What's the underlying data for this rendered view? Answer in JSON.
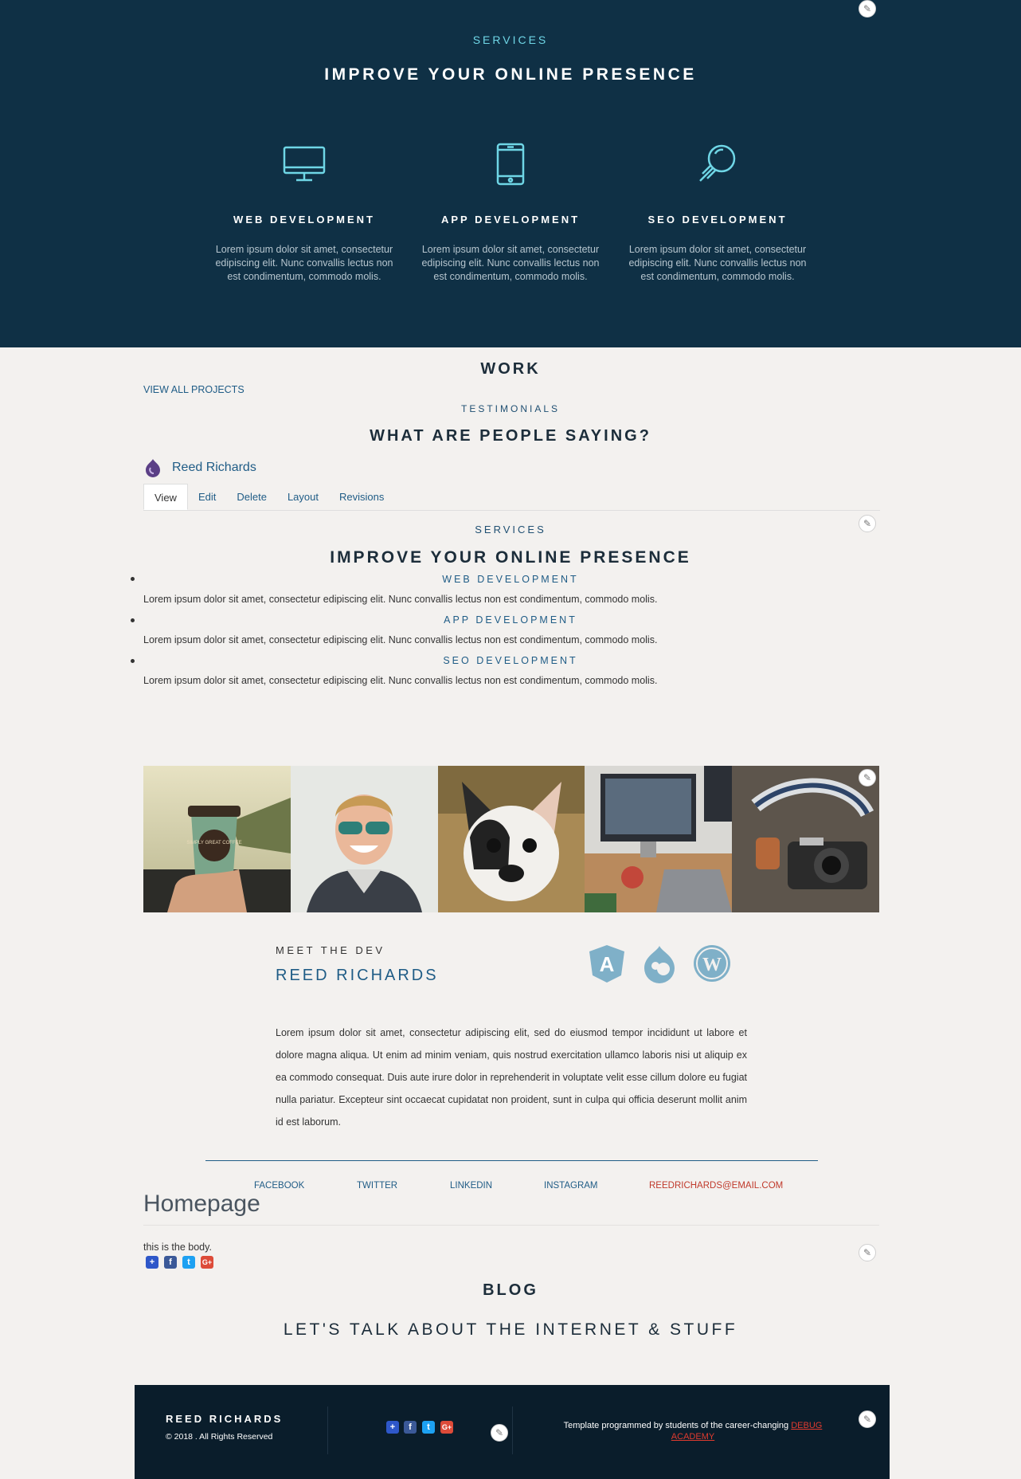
{
  "hero": {
    "eyebrow": "SERVICES",
    "headline": "IMPROVE YOUR ONLINE PRESENCE",
    "services": [
      {
        "title": "WEB DEVELOPMENT",
        "icon": "monitor-icon",
        "desc": "Lorem ipsum dolor sit amet, consectetur edipiscing elit. Nunc convallis lectus non est condimentum, commodo molis."
      },
      {
        "title": "APP DEVELOPMENT",
        "icon": "mobile-icon",
        "desc": "Lorem ipsum dolor sit amet, consectetur edipiscing elit. Nunc convallis lectus non est condimentum, commodo molis."
      },
      {
        "title": "SEO DEVELOPMENT",
        "icon": "magnifier-icon",
        "desc": "Lorem ipsum dolor sit amet, consectetur edipiscing elit. Nunc convallis lectus non est condimentum, commodo molis."
      }
    ]
  },
  "work": {
    "title": "WORK",
    "view_all": "VIEW ALL PROJECTS"
  },
  "testimonials": {
    "eyebrow": "TESTIMONIALS",
    "headline": "WHAT ARE PEOPLE SAYING?"
  },
  "author": {
    "name": "Reed Richards"
  },
  "tabs": [
    "View",
    "Edit",
    "Delete",
    "Layout",
    "Revisions"
  ],
  "services_list": {
    "eyebrow": "SERVICES",
    "headline": "IMPROVE YOUR ONLINE PRESENCE",
    "items": [
      {
        "title": "WEB DEVELOPMENT",
        "body": "Lorem ipsum dolor sit amet, consectetur edipiscing elit. Nunc convallis lectus non est condimentum, commodo molis."
      },
      {
        "title": "APP DEVELOPMENT",
        "body": "Lorem ipsum dolor sit amet, consectetur edipiscing elit. Nunc convallis lectus non est condimentum, commodo molis."
      },
      {
        "title": "SEO DEVELOPMENT",
        "body": "Lorem ipsum dolor sit amet, consectetur edipiscing elit. Nunc convallis lectus non est condimentum, commodo molis."
      }
    ]
  },
  "gallery": {
    "cup_text": "SIMPLY GREAT COFFEE"
  },
  "meet": {
    "eyebrow": "MEET THE DEV",
    "name": "REED RICHARDS",
    "tech_icons": [
      "angular-icon",
      "drupal-icon",
      "wordpress-icon"
    ],
    "about": "Lorem ipsum dolor sit amet, consectetur adipiscing elit, sed do eiusmod tempor incididunt ut labore et dolore magna aliqua. Ut enim ad minim veniam, quis nostrud exercitation ullamco laboris nisi ut aliquip ex ea commodo consequat. Duis aute irure dolor in reprehenderit in voluptate velit esse cillum dolore eu fugiat nulla pariatur. Excepteur sint occaecat cupidatat non proident, sunt in culpa qui officia deserunt mollit anim id est laborum."
  },
  "social": {
    "facebook": "FACEBOOK",
    "twitter": "TWITTER",
    "linkedin": "LINKEDIN",
    "instagram": "INSTAGRAM",
    "email": "REEDRICHARDS@EMAIL.COM"
  },
  "page": {
    "title": "Homepage",
    "body": "this is the body."
  },
  "blog": {
    "title": "BLOG",
    "headline": "LET'S TALK ABOUT THE INTERNET & STUFF"
  },
  "footer": {
    "name": "REED RICHARDS",
    "copyright": "© 2018 . All Rights Reserved",
    "credit": "Template programmed by students of the career-changing",
    "credit_link": "DEBUG ACADEMY"
  },
  "colors": {
    "hero_bg": "#0f3045",
    "accent": "#6fd6e6",
    "link": "#1f5c86",
    "footer_bg": "#0a1d2b",
    "page_bg": "#f3f1ef",
    "email_red": "#c0392b"
  }
}
